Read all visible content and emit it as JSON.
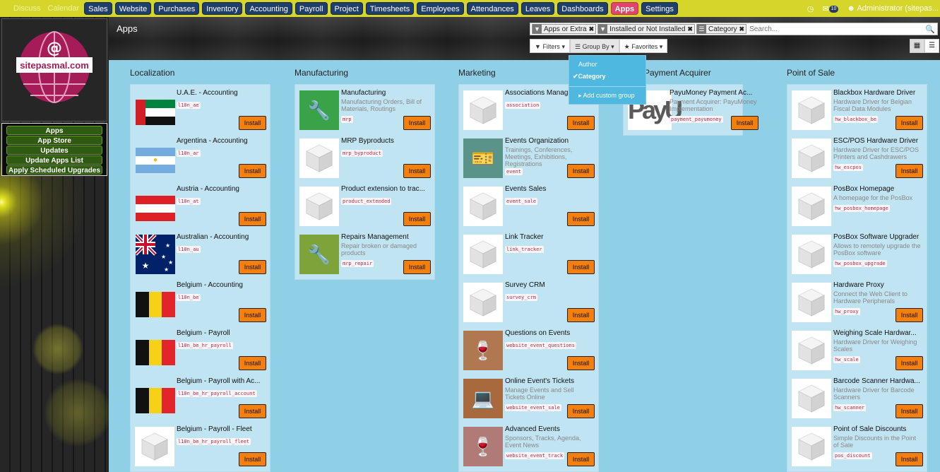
{
  "topbar": {
    "faded": [
      "Discuss",
      "Calendar"
    ],
    "menu": [
      "Sales",
      "Website",
      "Purchases",
      "Inventory",
      "Accounting",
      "Payroll",
      "Project",
      "Timesheets",
      "Employees",
      "Attendances",
      "Leaves",
      "Dashboards",
      "Apps",
      "Settings"
    ],
    "active": "Apps",
    "messages_count": "10",
    "user": "Administrator (sitepas..."
  },
  "sidebar": {
    "logo_text": "sitepasmal.com",
    "logo_symbol": "@",
    "items": [
      "Apps",
      "App Store",
      "Updates",
      "Update Apps List",
      "Apply Scheduled Upgrades"
    ]
  },
  "header": {
    "title": "Apps"
  },
  "search": {
    "facets": [
      {
        "icon": "filter-icon",
        "label": "Apps or Extra"
      },
      {
        "icon": "filter-icon",
        "label": "Installed or Not Installed"
      },
      {
        "icon": "list-icon",
        "label": "Category"
      }
    ],
    "placeholder": "Search..."
  },
  "buttons": {
    "filters": "Filters",
    "group_by": "Group By",
    "favorites": "Favorites"
  },
  "group_by_menu": {
    "items": [
      "Author",
      "Category"
    ],
    "selected": "Category",
    "custom": "Add custom group"
  },
  "install_label": "Install",
  "columns": [
    {
      "title": "Localization",
      "apps": [
        {
          "name": "U.A.E. - Accounting",
          "tech": "l10n_ae",
          "icon": "flag-uae"
        },
        {
          "name": "Argentina - Accounting",
          "tech": "l10n_ar",
          "icon": "flag-argentina"
        },
        {
          "name": "Austria - Accounting",
          "tech": "l10n_at",
          "icon": "flag-austria"
        },
        {
          "name": "Australian - Accounting",
          "tech": "l10n_au",
          "icon": "flag-australia"
        },
        {
          "name": "Belgium - Accounting",
          "tech": "l10n_be",
          "icon": "flag-belgium"
        },
        {
          "name": "Belgium - Payroll",
          "tech": "l10n_be_hr_payroll",
          "icon": "flag-belgium"
        },
        {
          "name": "Belgium - Payroll with Ac...",
          "tech": "l10n_be_hr_payroll_account",
          "icon": "flag-belgium"
        },
        {
          "name": "Belgium - Payroll - Fleet",
          "tech": "l10n_be_hr_payroll_fleet",
          "icon": "cube"
        }
      ]
    },
    {
      "title": "Manufacturing",
      "apps": [
        {
          "name": "Manufacturing",
          "desc": "Manufacturing Orders, Bill of Materials, Routings",
          "tech": "mrp",
          "icon": "wrench-green"
        },
        {
          "name": "MRP Byproducts",
          "tech": "mrp_byproduct",
          "icon": "cube"
        },
        {
          "name": "Product extension to trac...",
          "tech": "product_extended",
          "icon": "cube"
        },
        {
          "name": "Repairs Management",
          "desc": "Repair broken or damaged products",
          "tech": "mrp_repair",
          "icon": "wrench-olive"
        }
      ]
    },
    {
      "title": "Marketing",
      "apps": [
        {
          "name": "Associations Manage...",
          "tech": "association",
          "icon": "cube"
        },
        {
          "name": "Events Organization",
          "desc": "Trainings, Conferences, Meetings, Exhibitions, Registrations",
          "tech": "event",
          "icon": "ticket"
        },
        {
          "name": "Events Sales",
          "tech": "event_sale",
          "icon": "cube"
        },
        {
          "name": "Link Tracker",
          "tech": "link_tracker",
          "icon": "cube"
        },
        {
          "name": "Survey CRM",
          "tech": "survey_crm",
          "icon": "cube"
        },
        {
          "name": "Questions on Events",
          "tech": "website_event_questions",
          "icon": "glasses"
        },
        {
          "name": "Online Event's Tickets",
          "desc": "Manage Events and Sell Tickets Online",
          "tech": "website_event_sale",
          "icon": "laptop-ticket"
        },
        {
          "name": "Advanced Events",
          "desc": "Sponsors, Tracks, Agenda, Event News",
          "tech": "website_event_track",
          "icon": "glasses-plus"
        }
      ]
    },
    {
      "title": "Payment Acquirer",
      "apps": [
        {
          "name": "PayuMoney Payment Ac...",
          "desc": "Payment Acquirer: PayuMoney Implementation",
          "tech": "payment_payumoney",
          "icon": "payu"
        }
      ]
    },
    {
      "title": "Point of Sale",
      "apps": [
        {
          "name": "Blackbox Hardware Driver",
          "desc": "Hardware Driver for Belgian Fiscal Data Modules",
          "tech": "hw_blackbox_be",
          "icon": "cube"
        },
        {
          "name": "ESC/POS Hardware Driver",
          "desc": "Hardware Driver for ESC/POS Printers and Cashdrawers",
          "tech": "hw_escpos",
          "icon": "cube"
        },
        {
          "name": "PosBox Homepage",
          "desc": "A homepage for the PosBox",
          "tech": "hw_posbox_homepage",
          "icon": "cube",
          "installed": true
        },
        {
          "name": "PosBox Software Upgrader",
          "desc": "Allows to remotely upgrade the PosBox software",
          "tech": "hw_posbox_upgrade",
          "icon": "cube",
          "installed": true
        },
        {
          "name": "Hardware Proxy",
          "desc": "Connect the Web Client to Hardware Peripherals",
          "tech": "hw_proxy",
          "icon": "cube"
        },
        {
          "name": "Weighing Scale Hardwar...",
          "desc": "Hardware Driver for Weighing Scales",
          "tech": "hw_scale",
          "icon": "cube"
        },
        {
          "name": "Barcode Scanner Hardwa...",
          "desc": "Hardware Driver for Barcode Scanners",
          "tech": "hw_scanner",
          "icon": "cube"
        },
        {
          "name": "Point of Sale Discounts",
          "desc": "Simple Discounts in the Point of Sale",
          "tech": "pos_discount",
          "icon": "cube"
        }
      ]
    }
  ]
}
